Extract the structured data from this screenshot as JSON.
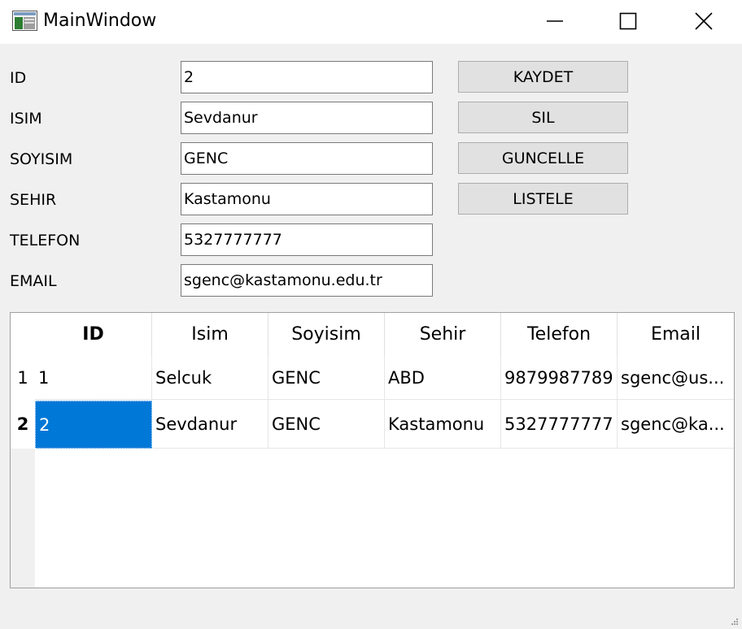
{
  "window": {
    "title": "MainWindow"
  },
  "form": {
    "fields": [
      {
        "label": "ID",
        "value": "2"
      },
      {
        "label": "ISIM",
        "value": "Sevdanur"
      },
      {
        "label": "SOYISIM",
        "value": "GENC"
      },
      {
        "label": "SEHIR",
        "value": "Kastamonu"
      },
      {
        "label": "TELEFON",
        "value": "5327777777"
      },
      {
        "label": "EMAIL",
        "value": "sgenc@kastamonu.edu.tr"
      }
    ],
    "buttons": [
      {
        "label": "KAYDET"
      },
      {
        "label": "SIL"
      },
      {
        "label": "GUNCELLE"
      },
      {
        "label": "LISTELE"
      }
    ]
  },
  "table": {
    "columns": [
      "ID",
      "Isim",
      "Soyisim",
      "Sehir",
      "Telefon",
      "Email"
    ],
    "rows": [
      {
        "num": "1",
        "cells": [
          "1",
          "Selcuk",
          "GENC",
          "ABD",
          "9879987789",
          "sgenc@us..."
        ]
      },
      {
        "num": "2",
        "cells": [
          "2",
          "Sevdanur",
          "GENC",
          "Kastamonu",
          "5327777777",
          "sgenc@ka..."
        ]
      }
    ],
    "selected": {
      "row": 2,
      "column": "ID"
    }
  },
  "colors": {
    "selection": "#0078d7",
    "background": "#f0f0f0",
    "button": "#e1e1e1"
  }
}
